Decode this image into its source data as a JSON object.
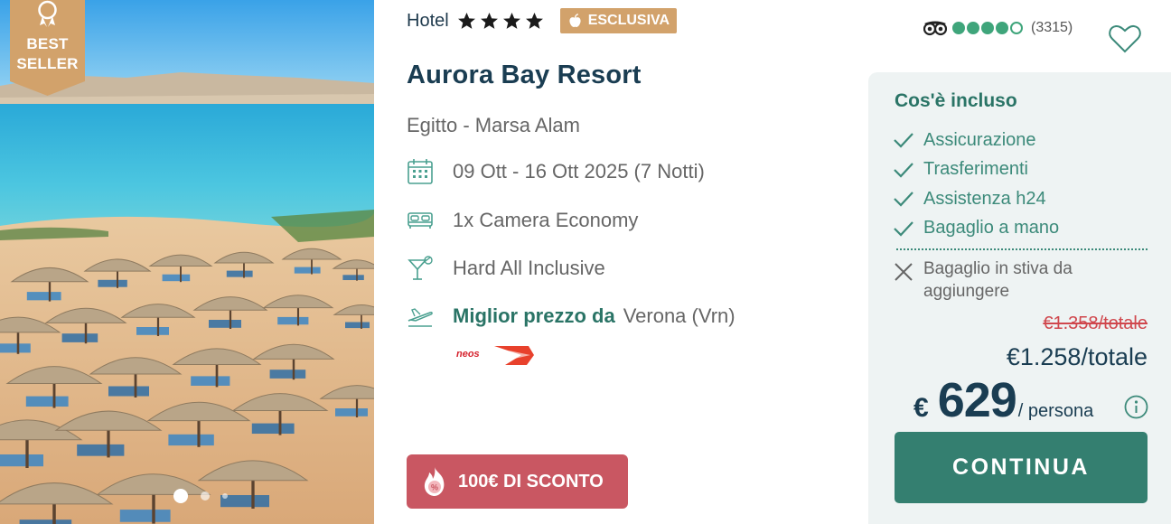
{
  "photo": {
    "badge_line1": "BEST",
    "badge_line2": "SELLER",
    "slides": 3,
    "active_slide": 1
  },
  "hotel": {
    "label": "Hotel",
    "stars": 4,
    "exclusive_label": "ESCLUSIVA",
    "name": "Aurora Bay Resort",
    "location": "Egitto - Marsa Alam"
  },
  "details": {
    "dates": "09 Ott - 16 Ott 2025 (7 Notti)",
    "room": "1x Camera Economy",
    "board": "Hard All Inclusive",
    "flight_label": "Miglior prezzo da",
    "flight_origin": "Verona (Vrn)",
    "airline": "neos"
  },
  "discount": {
    "label": "100€ DI SCONTO"
  },
  "rating": {
    "bubbles": 4,
    "max_bubbles": 5,
    "count": "(3315)"
  },
  "included": {
    "title": "Cos'è incluso",
    "items": [
      "Assicurazione",
      "Trasferimenti",
      "Assistenza h24",
      "Bagaglio a mano"
    ],
    "excluded": "Bagaglio in stiva da aggiungere"
  },
  "price": {
    "old_total": "€1.358/totale",
    "total": "€1.258/totale",
    "currency": "€",
    "per_person": "629",
    "per_person_unit": "/ persona"
  },
  "cta": {
    "label": "CONTINUA"
  },
  "colors": {
    "accent": "#347f70",
    "badge": "#d2a26b",
    "discount": "#c95762",
    "old_price": "#d0474d",
    "title": "#1a3d52"
  }
}
